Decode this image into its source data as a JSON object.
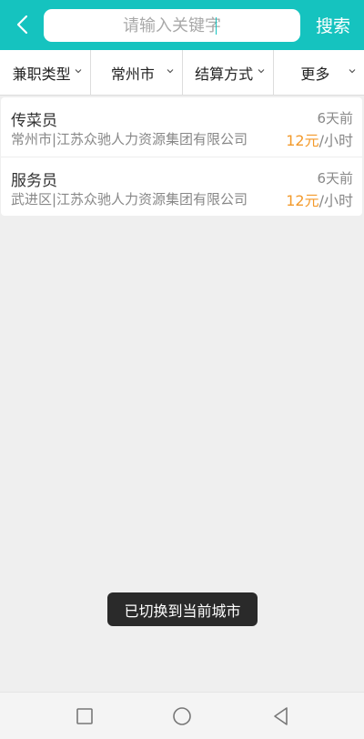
{
  "header": {
    "search_placeholder": "请输入关键字",
    "search_button_label": "搜索"
  },
  "filters": [
    {
      "label": "兼职类型"
    },
    {
      "label": "常州市"
    },
    {
      "label": "结算方式"
    },
    {
      "label": "更多"
    }
  ],
  "jobs": [
    {
      "title": "传菜员",
      "company": "常州市|江苏众驰人力资源集团有限公司",
      "time": "6天前",
      "pay_amount": "12元",
      "pay_unit": "/小时"
    },
    {
      "title": "服务员",
      "company": "武进区|江苏众驰人力资源集团有限公司",
      "time": "6天前",
      "pay_amount": "12元",
      "pay_unit": "/小时"
    }
  ],
  "toast": {
    "message": "已切换到当前城市"
  },
  "colors": {
    "accent": "#15c3bf",
    "pay": "#f39a2b",
    "toast_bg": "#2a2a2a"
  },
  "icons": {
    "back": "chevron-left-icon",
    "filter_chevron": "chevron-down-icon",
    "nav_recent": "square-icon",
    "nav_home": "circle-icon",
    "nav_back": "triangle-back-icon"
  }
}
